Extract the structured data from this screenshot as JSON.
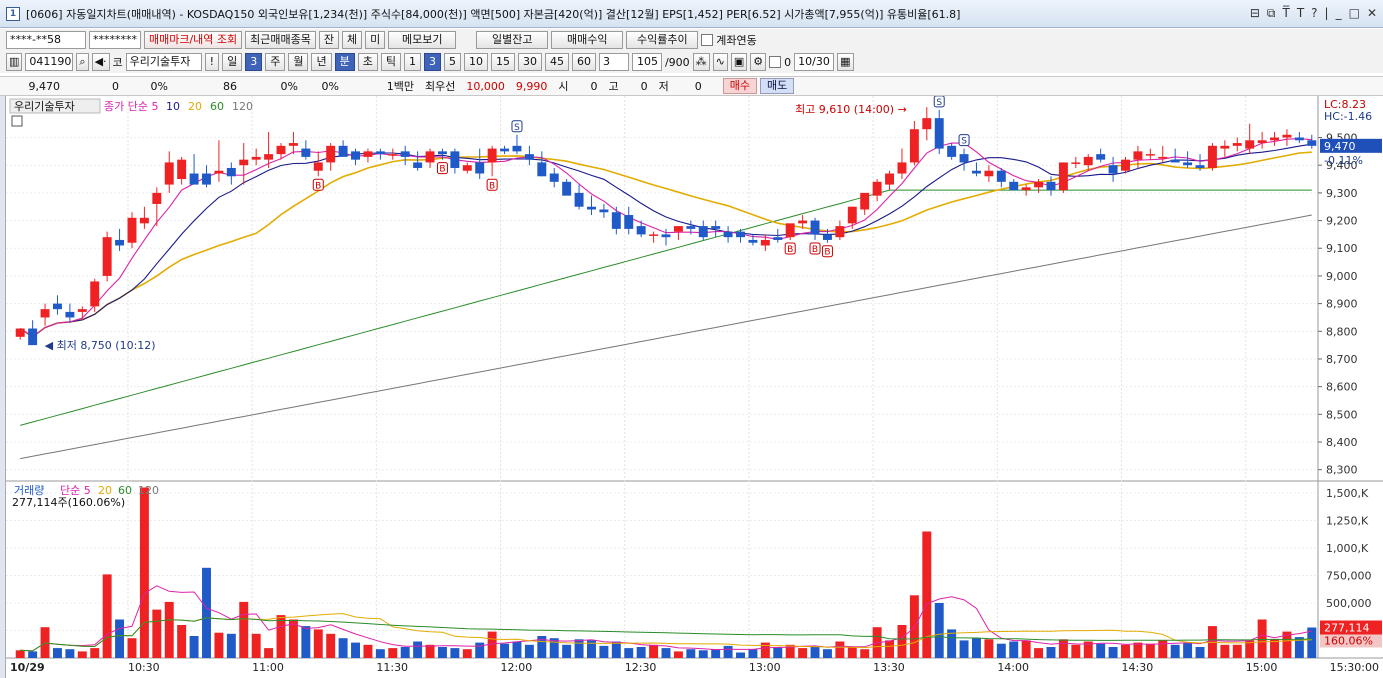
{
  "window": {
    "num": "1",
    "title": "[0606] 자동일지차트(매매내역) - KOSDAQ150 외국인보유[1,234(천)] 주식수[84,000(천)] 액면[500] 자본금[420(억)] 결산[12월] EPS[1,452] PER[6.52] 시가총액[7,955(억)] 유통비율[61.8]",
    "controls": [
      "⊟",
      "⧉",
      "T̅",
      "T",
      "?",
      "|",
      "_",
      "□",
      "✕"
    ]
  },
  "toolbar1": {
    "account": "****-**58",
    "password": "********",
    "trade_mark_btn": "매매마크/내역 조회",
    "recent_btn": "최근매매종목",
    "jan": "잔",
    "che": "체",
    "mi": "미",
    "memo_btn": "메모보기",
    "daily_balance_btn": "일별잔고",
    "trade_profit_btn": "매매수익",
    "profit_trend_btn": "수익률추이",
    "account_link_label": "계좌연동"
  },
  "toolbar2": {
    "code": "041190",
    "name": "우리기술투자",
    "kind": "코",
    "bang": "!",
    "il": "일",
    "il_num": "3",
    "periods": [
      "주",
      "월",
      "년",
      "분",
      "초",
      "틱"
    ],
    "nums": [
      "1",
      "3",
      "5",
      "10",
      "15",
      "30",
      "45",
      "60"
    ],
    "sel_num": "3",
    "count_sel": "3",
    "count": "105",
    "count_total": "/900",
    "zero": "0",
    "date": "10/30"
  },
  "quote": {
    "price": "9,470",
    "change": "0",
    "change_pct": "0%",
    "vol": "86",
    "pct2": "0%",
    "pct3": "0%",
    "unit": "1백만",
    "best": "최우선",
    "ask": "10,000",
    "bid": "9,990",
    "si": "시",
    "si_v": "0",
    "go": "고",
    "go_v": "0",
    "jeo": "저",
    "jeo_v": "0",
    "buy": "매수",
    "sell": "매도"
  },
  "chart_data": {
    "type": "candlestick",
    "symbol_label": "우리기술투자",
    "legend_price": {
      "name": "종가 단순",
      "periods": [
        "5",
        "10",
        "20",
        "60",
        "120"
      ]
    },
    "legend_volume": {
      "name": "거래량",
      "ma": "단순 5",
      "periods": [
        "20",
        "60",
        "120"
      ]
    },
    "volume_readout": "277,114주(160.06%)",
    "lc": "LC:8.23",
    "hc": "HC:-1.46",
    "current_price": "9,470",
    "current_pct": "-0.11%",
    "current_volume": "277,114",
    "current_volume_pct": "160.06%",
    "high_note": "최고 9,610 (14:00)",
    "low_note": "최저 8,750 (10:12)",
    "price_ticks": [
      "9,500",
      "9,400",
      "9,300",
      "9,200",
      "9,100",
      "9,000",
      "8,900",
      "8,800",
      "8,700",
      "8,600",
      "8,500",
      "8,400",
      "8,300"
    ],
    "price_ylim": [
      8270,
      9650
    ],
    "volume_ticks": [
      "1,500,K",
      "1,250,K",
      "1,000,K",
      "750,000",
      "500,000",
      "250,000"
    ],
    "volume_ylim": [
      0,
      1600000
    ],
    "time_labels": [
      "10/29",
      "10:30",
      "11:00",
      "11:30",
      "12:00",
      "12:30",
      "13:00",
      "13:30",
      "14:00",
      "14:30",
      "15:00",
      "15:30:00"
    ],
    "candles": [
      [
        8780,
        8810,
        8770,
        8810
      ],
      [
        8810,
        8840,
        8760,
        8750
      ],
      [
        8850,
        8900,
        8820,
        8880
      ],
      [
        8900,
        8930,
        8860,
        8880
      ],
      [
        8870,
        8900,
        8830,
        8850
      ],
      [
        8870,
        8890,
        8840,
        8880
      ],
      [
        8890,
        8990,
        8870,
        8980
      ],
      [
        9000,
        9160,
        8980,
        9140
      ],
      [
        9130,
        9170,
        9090,
        9110
      ],
      [
        9120,
        9230,
        9100,
        9210
      ],
      [
        9190,
        9250,
        9170,
        9210
      ],
      [
        9260,
        9320,
        9180,
        9300
      ],
      [
        9330,
        9450,
        9300,
        9410
      ],
      [
        9350,
        9430,
        9330,
        9420
      ],
      [
        9370,
        9440,
        9330,
        9330
      ],
      [
        9370,
        9400,
        9320,
        9330
      ],
      [
        9370,
        9490,
        9340,
        9380
      ],
      [
        9390,
        9410,
        9330,
        9360
      ],
      [
        9400,
        9480,
        9330,
        9420
      ],
      [
        9420,
        9460,
        9400,
        9430
      ],
      [
        9420,
        9520,
        9390,
        9440
      ],
      [
        9440,
        9480,
        9420,
        9470
      ],
      [
        9470,
        9520,
        9440,
        9480
      ],
      [
        9460,
        9490,
        9420,
        9430
      ],
      [
        9380,
        9450,
        9360,
        9410
      ],
      [
        9410,
        9480,
        9380,
        9470
      ],
      [
        9470,
        9490,
        9440,
        9430
      ],
      [
        9450,
        9460,
        9400,
        9420
      ],
      [
        9430,
        9460,
        9410,
        9450
      ],
      [
        9450,
        9460,
        9420,
        9440
      ],
      [
        9440,
        9460,
        9420,
        9440
      ],
      [
        9450,
        9470,
        9400,
        9430
      ],
      [
        9410,
        9450,
        9380,
        9390
      ],
      [
        9410,
        9460,
        9390,
        9450
      ],
      [
        9450,
        9460,
        9420,
        9440
      ],
      [
        9450,
        9460,
        9370,
        9390
      ],
      [
        9380,
        9410,
        9370,
        9400
      ],
      [
        9410,
        9460,
        9350,
        9370
      ],
      [
        9410,
        9470,
        9360,
        9460
      ],
      [
        9460,
        9470,
        9440,
        9450
      ],
      [
        9470,
        9510,
        9440,
        9450
      ],
      [
        9440,
        9470,
        9400,
        9420
      ],
      [
        9410,
        9450,
        9360,
        9360
      ],
      [
        9370,
        9390,
        9320,
        9340
      ],
      [
        9340,
        9350,
        9300,
        9290
      ],
      [
        9300,
        9330,
        9240,
        9250
      ],
      [
        9250,
        9290,
        9220,
        9240
      ],
      [
        9240,
        9260,
        9210,
        9230
      ],
      [
        9230,
        9250,
        9150,
        9170
      ],
      [
        9220,
        9250,
        9150,
        9170
      ],
      [
        9180,
        9200,
        9140,
        9150
      ],
      [
        9150,
        9160,
        9120,
        9150
      ],
      [
        9150,
        9170,
        9110,
        9140
      ],
      [
        9160,
        9180,
        9130,
        9180
      ],
      [
        9180,
        9200,
        9150,
        9170
      ],
      [
        9180,
        9200,
        9130,
        9140
      ],
      [
        9180,
        9200,
        9140,
        9170
      ],
      [
        9160,
        9180,
        9120,
        9140
      ],
      [
        9160,
        9170,
        9120,
        9140
      ],
      [
        9130,
        9150,
        9110,
        9120
      ],
      [
        9110,
        9150,
        9090,
        9130
      ],
      [
        9140,
        9170,
        9120,
        9130
      ],
      [
        9140,
        9180,
        9130,
        9190
      ],
      [
        9190,
        9220,
        9170,
        9200
      ],
      [
        9200,
        9210,
        9130,
        9150
      ],
      [
        9150,
        9170,
        9120,
        9130
      ],
      [
        9140,
        9200,
        9130,
        9180
      ],
      [
        9190,
        9250,
        9170,
        9250
      ],
      [
        9240,
        9300,
        9220,
        9300
      ],
      [
        9290,
        9350,
        9270,
        9340
      ],
      [
        9330,
        9380,
        9310,
        9370
      ],
      [
        9370,
        9460,
        9350,
        9410
      ],
      [
        9410,
        9560,
        9400,
        9530
      ],
      [
        9530,
        9610,
        9490,
        9570
      ],
      [
        9570,
        9600,
        9440,
        9460
      ],
      [
        9470,
        9480,
        9420,
        9430
      ],
      [
        9440,
        9460,
        9380,
        9410
      ],
      [
        9380,
        9410,
        9360,
        9370
      ],
      [
        9360,
        9400,
        9340,
        9380
      ],
      [
        9380,
        9390,
        9320,
        9340
      ],
      [
        9340,
        9350,
        9310,
        9310
      ],
      [
        9310,
        9330,
        9290,
        9320
      ],
      [
        9320,
        9350,
        9300,
        9340
      ],
      [
        9340,
        9360,
        9290,
        9310
      ],
      [
        9310,
        9410,
        9300,
        9410
      ],
      [
        9410,
        9430,
        9390,
        9410
      ],
      [
        9400,
        9440,
        9380,
        9430
      ],
      [
        9440,
        9460,
        9410,
        9420
      ],
      [
        9400,
        9430,
        9340,
        9370
      ],
      [
        9380,
        9430,
        9370,
        9420
      ],
      [
        9420,
        9470,
        9390,
        9450
      ],
      [
        9440,
        9460,
        9420,
        9440
      ],
      [
        9430,
        9470,
        9410,
        9430
      ],
      [
        9420,
        9460,
        9410,
        9410
      ],
      [
        9410,
        9450,
        9390,
        9400
      ],
      [
        9400,
        9440,
        9380,
        9390
      ],
      [
        9390,
        9480,
        9380,
        9470
      ],
      [
        9460,
        9490,
        9430,
        9470
      ],
      [
        9470,
        9500,
        9450,
        9480
      ],
      [
        9460,
        9550,
        9440,
        9490
      ],
      [
        9480,
        9520,
        9460,
        9490
      ],
      [
        9490,
        9520,
        9470,
        9500
      ],
      [
        9500,
        9530,
        9470,
        9510
      ],
      [
        9500,
        9520,
        9480,
        9490
      ],
      [
        9490,
        9510,
        9460,
        9470
      ]
    ],
    "volumes": [
      70000,
      60000,
      280000,
      90000,
      80000,
      60000,
      90000,
      760000,
      350000,
      180000,
      1550000,
      440000,
      510000,
      300000,
      200000,
      820000,
      230000,
      220000,
      510000,
      220000,
      90000,
      390000,
      350000,
      290000,
      260000,
      220000,
      180000,
      140000,
      120000,
      80000,
      90000,
      100000,
      150000,
      120000,
      100000,
      90000,
      80000,
      140000,
      240000,
      130000,
      150000,
      120000,
      200000,
      180000,
      120000,
      170000,
      160000,
      110000,
      150000,
      90000,
      100000,
      120000,
      90000,
      60000,
      80000,
      70000,
      80000,
      110000,
      50000,
      80000,
      140000,
      100000,
      120000,
      90000,
      100000,
      80000,
      150000,
      100000,
      80000,
      280000,
      160000,
      300000,
      570000,
      1150000,
      500000,
      260000,
      160000,
      180000,
      170000,
      130000,
      150000,
      160000,
      90000,
      100000,
      170000,
      120000,
      150000,
      130000,
      100000,
      120000,
      140000,
      130000,
      160000,
      120000,
      140000,
      100000,
      290000,
      120000,
      120000,
      160000,
      350000,
      170000,
      240000,
      190000,
      277114
    ],
    "marks": [
      {
        "type": "B",
        "i": 24
      },
      {
        "type": "B",
        "i": 34
      },
      {
        "type": "B",
        "i": 38
      },
      {
        "type": "S",
        "i": 40
      },
      {
        "type": "B",
        "i": 62
      },
      {
        "type": "B",
        "i": 64
      },
      {
        "type": "B",
        "i": 65
      },
      {
        "type": "S",
        "i": 74
      },
      {
        "type": "S",
        "i": 76
      }
    ],
    "colors": {
      "up": "#ee2222",
      "down": "#1f5ac8",
      "ma5": "#dd22aa",
      "ma10": "#1a1a8c",
      "ma20": "#e2ac00",
      "ma60": "#2a8c2a",
      "ma120": "#777777",
      "mark": "#cc0000"
    }
  }
}
